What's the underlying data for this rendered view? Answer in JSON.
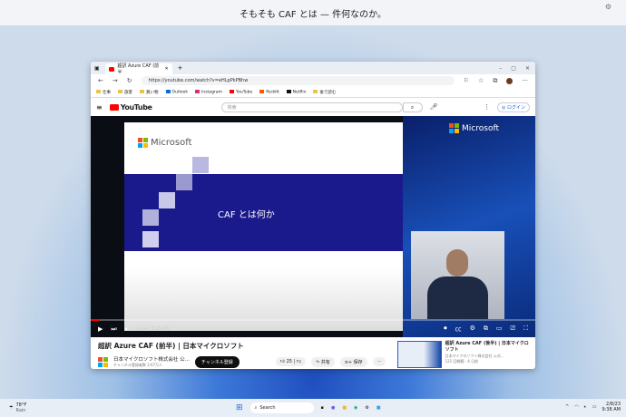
{
  "topbar": {
    "title": "そもそも CAF とは — 件何なのか。"
  },
  "browser": {
    "tab_title": "超訳 Azure CAF (前半",
    "new_tab": "+",
    "url": "https://youtube.com/watch?v=eHLpPkPBhw",
    "bookmarks": [
      "仕事",
      "旅客",
      "買い物",
      "Outlook",
      "Instagram",
      "YouTube",
      "Reddit",
      "Netflix",
      "後で読む"
    ]
  },
  "youtube": {
    "logo": "YouTube",
    "search_placeholder": "検索",
    "login": "ログイン"
  },
  "slide": {
    "brand": "Microsoft",
    "title": "CAF とは何か"
  },
  "player": {
    "time": "1:04 / 1:25:48",
    "progress": 0.02
  },
  "video": {
    "title": "超訳 Azure CAF (前半) | 日本マイクロソフト",
    "channel": "日本マイクロソフト株式会社 公...",
    "subscribers": "チャンネル登録者数 3.67万人",
    "subscribe": "チャンネル登録",
    "likes": "25",
    "share": "共有",
    "save": "保存",
    "more": "···"
  },
  "related": {
    "title": "超訳 Azure CAF (後半) | 日本マイクロソフト",
    "channel": "日本マイクロソフト株式会社 公式...",
    "meta": "121 回視聴 · 4 日前"
  },
  "taskbar": {
    "weather_temp": "78°F",
    "weather_text": "Rain",
    "search": "Search",
    "date": "2/8/23",
    "time": "9:38 AM"
  }
}
